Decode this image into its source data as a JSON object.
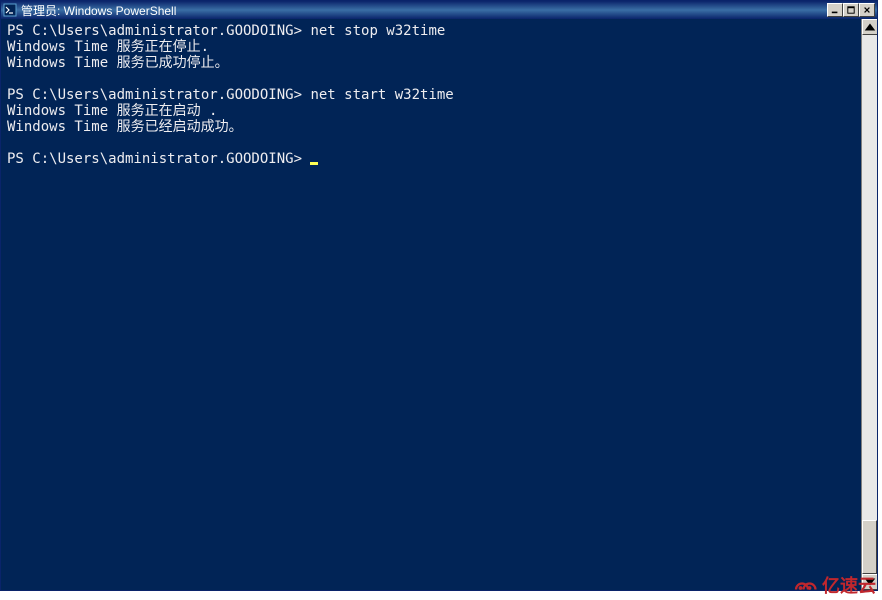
{
  "window": {
    "title": "管理员: Windows PowerShell"
  },
  "terminal": {
    "lines": [
      {
        "type": "cmd",
        "prompt": "PS C:\\Users\\administrator.GOODOING>",
        "command": "net stop w32time"
      },
      {
        "type": "out",
        "text": "Windows Time 服务正在停止."
      },
      {
        "type": "out",
        "text": "Windows Time 服务已成功停止。"
      },
      {
        "type": "blank"
      },
      {
        "type": "cmd",
        "prompt": "PS C:\\Users\\administrator.GOODOING>",
        "command": "net start w32time"
      },
      {
        "type": "out",
        "text": "Windows Time 服务正在启动 ."
      },
      {
        "type": "out",
        "text": "Windows Time 服务已经启动成功。"
      },
      {
        "type": "blank"
      },
      {
        "type": "cmd",
        "prompt": "PS C:\\Users\\administrator.GOODOING>",
        "command": "",
        "cursor": true
      },
      {
        "type": "blank"
      }
    ]
  },
  "scrollbar": {
    "thumb_top_pct": 90,
    "thumb_height_pct": 10
  },
  "watermark": {
    "text": "亿速云"
  }
}
